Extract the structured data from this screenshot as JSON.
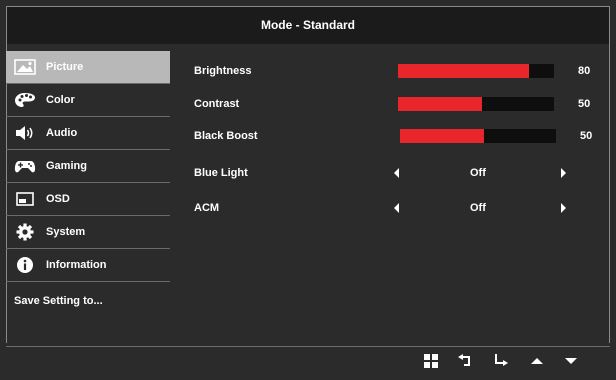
{
  "header": {
    "title": "Mode - Standard"
  },
  "sidebar": {
    "items": [
      {
        "label": "Picture",
        "icon": "picture-icon",
        "active": true
      },
      {
        "label": "Color",
        "icon": "palette-icon"
      },
      {
        "label": "Audio",
        "icon": "speaker-icon"
      },
      {
        "label": "Gaming",
        "icon": "gamepad-icon"
      },
      {
        "label": "OSD",
        "icon": "osd-icon"
      },
      {
        "label": "System",
        "icon": "gear-icon"
      },
      {
        "label": "Information",
        "icon": "info-icon"
      },
      {
        "label": "Save Setting to..."
      }
    ]
  },
  "settings": {
    "brightness": {
      "label": "Brightness",
      "value": "80",
      "level": 0.84
    },
    "contrast": {
      "label": "Contrast",
      "value": "50",
      "level": 0.54
    },
    "black_boost": {
      "label": "Black Boost",
      "value": "50",
      "level": 0.54
    },
    "blue_light": {
      "label": "Blue Light",
      "value": "Off"
    },
    "acm": {
      "label": "ACM",
      "value": "Off"
    }
  },
  "footer": {
    "buttons": [
      "windows-icon",
      "return-icon",
      "enter-icon",
      "up-arrow-icon",
      "down-arrow-icon"
    ]
  },
  "colors": {
    "background": "#2b2b2b",
    "header_bg": "#1b1b1b",
    "accent": "#e8262b",
    "active_item": "#b8b8b8"
  }
}
